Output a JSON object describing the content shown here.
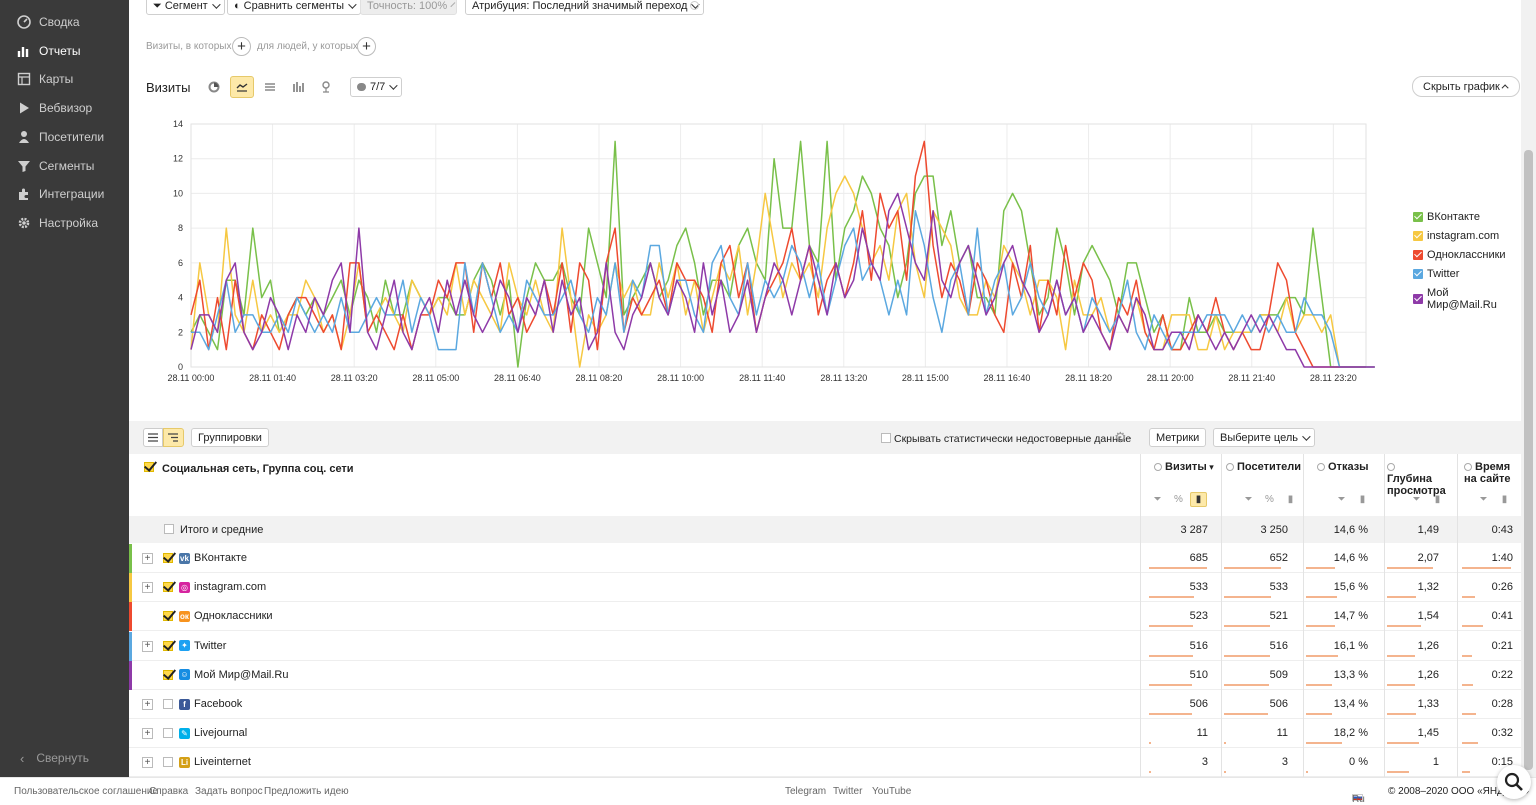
{
  "sidebar": {
    "items": [
      {
        "label": "Сводка",
        "icon": "dashboard-icon"
      },
      {
        "label": "Отчеты",
        "icon": "bar-chart-icon",
        "active": true
      },
      {
        "label": "Карты",
        "icon": "map-icon"
      },
      {
        "label": "Вебвизор",
        "icon": "play-icon"
      },
      {
        "label": "Посетители",
        "icon": "user-icon"
      },
      {
        "label": "Сегменты",
        "icon": "filter-icon"
      },
      {
        "label": "Интеграции",
        "icon": "puzzle-icon"
      },
      {
        "label": "Настройка",
        "icon": "gear-icon"
      }
    ],
    "collapse_label": "Свернуть"
  },
  "toolbar": {
    "segment_label": "Сегмент",
    "compare_label": "Сравнить сегменты",
    "accuracy_label": "Точность: 100%",
    "attribution_label": "Атрибуция: Последний значимый переход"
  },
  "conditions": {
    "visits_label": "Визиты, в которых",
    "people_label": "для людей, у которых"
  },
  "chart_header": {
    "title": "Визиты",
    "series_count": "7/7",
    "hide_chart_label": "Скрыть график"
  },
  "chart_data": {
    "type": "line",
    "ylim": [
      0,
      14
    ],
    "yticks": [
      0,
      2,
      4,
      6,
      8,
      10,
      12,
      14
    ],
    "xticks": [
      "28.11 00:00",
      "28.11 01:40",
      "28.11 03:20",
      "28.11 05:00",
      "28.11 06:40",
      "28.11 08:20",
      "28.11 10:00",
      "28.11 11:40",
      "28.11 13:20",
      "28.11 15:00",
      "28.11 16:40",
      "28.11 18:20",
      "28.11 20:00",
      "28.11 21:40",
      "28.11 23:20"
    ],
    "series": [
      {
        "name": "ВКонтакте",
        "color": "#79c04a",
        "values": [
          2,
          3,
          2,
          1,
          5,
          5,
          3,
          8,
          4,
          5,
          2,
          3,
          4,
          3,
          4,
          3,
          4,
          5,
          3,
          5,
          4,
          2,
          5,
          3,
          3,
          5,
          4,
          3,
          4,
          4,
          3,
          3,
          5,
          6,
          5,
          3,
          5,
          0,
          4,
          6,
          5,
          5,
          6,
          4,
          3,
          8,
          6,
          4,
          13,
          3,
          4,
          5,
          6,
          4,
          5,
          7,
          8,
          6,
          3,
          5,
          5,
          4,
          7,
          8,
          6,
          5,
          12,
          8,
          8,
          13,
          7,
          6,
          13,
          5,
          8,
          9,
          11,
          10,
          8,
          7,
          4,
          6,
          10,
          11,
          11,
          7,
          9,
          6,
          7,
          4,
          4,
          3,
          9,
          10,
          9,
          6,
          3,
          4,
          8,
          6,
          3,
          6,
          7,
          6,
          5,
          3,
          6,
          6,
          4,
          2,
          3,
          1,
          1,
          4,
          2,
          2,
          3,
          2,
          2,
          2,
          2,
          3,
          3,
          3,
          4,
          4,
          3,
          8,
          4,
          0,
          0,
          0,
          0,
          0
        ]
      },
      {
        "name": "instagram.com",
        "color": "#f6c842",
        "values": [
          1,
          6,
          3,
          2,
          8,
          3,
          2,
          5,
          2,
          3,
          2,
          3,
          3,
          5,
          4,
          2,
          3,
          1,
          3,
          6,
          2,
          3,
          4,
          3,
          2,
          5,
          4,
          3,
          4,
          3,
          6,
          3,
          5,
          4,
          3,
          2,
          6,
          4,
          3,
          5,
          3,
          2,
          8,
          4,
          0,
          3,
          2,
          3,
          6,
          4,
          5,
          3,
          3,
          6,
          4,
          6,
          3,
          5,
          2,
          4,
          6,
          5,
          7,
          3,
          6,
          10,
          7,
          4,
          6,
          5,
          6,
          4,
          8,
          10,
          11,
          10,
          8,
          6,
          7,
          5,
          9,
          10,
          6,
          4,
          9,
          8,
          7,
          4,
          3,
          3,
          5,
          4,
          7,
          6,
          5,
          3,
          5,
          5,
          4,
          1,
          5,
          3,
          3,
          4,
          2,
          3,
          2,
          4,
          2,
          1,
          1,
          3,
          3,
          3,
          1,
          1,
          3,
          1,
          2,
          2,
          2,
          3,
          3,
          2,
          4,
          2,
          3,
          3,
          2,
          3,
          0,
          0,
          0,
          0,
          0
        ]
      },
      {
        "name": "Одноклассники",
        "color": "#ee4a2f",
        "values": [
          3,
          5,
          1,
          4,
          1,
          5,
          2,
          1,
          3,
          2,
          1,
          3,
          4,
          4,
          3,
          2,
          3,
          1,
          6,
          6,
          2,
          3,
          2,
          1,
          3,
          1,
          3,
          3,
          5,
          4,
          6,
          6,
          2,
          6,
          4,
          6,
          3,
          4,
          2,
          3,
          5,
          3,
          6,
          2,
          6,
          5,
          1,
          6,
          8,
          2,
          4,
          3,
          4,
          5,
          3,
          6,
          5,
          5,
          4,
          2,
          6,
          7,
          4,
          6,
          2,
          4,
          5,
          6,
          8,
          5,
          7,
          3,
          5,
          6,
          4,
          6,
          9,
          5,
          10,
          8,
          9,
          5,
          11,
          13,
          7,
          4,
          6,
          5,
          3,
          6,
          5,
          3,
          2,
          6,
          4,
          7,
          2,
          5,
          3,
          7,
          4,
          6,
          5,
          2,
          1,
          4,
          3,
          5,
          2,
          1,
          3,
          1,
          1,
          2,
          3,
          2,
          4,
          2,
          1,
          2,
          1,
          1,
          3,
          6,
          5,
          2,
          1,
          0,
          0,
          0,
          0,
          0,
          0,
          0
        ]
      },
      {
        "name": "Twitter",
        "color": "#5ba8e0",
        "values": [
          2,
          2,
          1,
          3,
          5,
          2,
          3,
          3,
          2,
          2,
          3,
          2,
          4,
          3,
          2,
          3,
          2,
          4,
          2,
          2,
          3,
          4,
          3,
          3,
          5,
          2,
          4,
          3,
          1,
          1,
          1,
          6,
          3,
          6,
          4,
          2,
          3,
          2,
          5,
          4,
          3,
          3,
          4,
          5,
          3,
          2,
          4,
          3,
          6,
          2,
          5,
          4,
          7,
          7,
          3,
          5,
          5,
          3,
          2,
          6,
          7,
          4,
          3,
          6,
          3,
          5,
          4,
          5,
          7,
          6,
          4,
          6,
          3,
          5,
          7,
          8,
          5,
          6,
          5,
          3,
          5,
          3,
          9,
          7,
          4,
          2,
          5,
          6,
          3,
          8,
          3,
          5,
          6,
          3,
          4,
          6,
          4,
          3,
          5,
          3,
          4,
          2,
          4,
          3,
          2,
          3,
          5,
          2,
          1,
          3,
          2,
          1,
          2,
          2,
          2,
          3,
          3,
          3,
          2,
          3,
          2,
          3,
          2,
          3,
          2,
          2,
          4,
          3,
          3,
          2,
          0,
          0,
          0,
          0,
          0
        ]
      },
      {
        "name": "Мой Мир@Mail.Ru",
        "color": "#8e3aa8",
        "values": [
          1,
          3,
          3,
          2,
          5,
          6,
          2,
          1,
          2,
          4,
          3,
          1,
          3,
          2,
          4,
          3,
          5,
          6,
          2,
          8,
          2,
          1,
          3,
          5,
          2,
          1,
          3,
          4,
          2,
          5,
          3,
          5,
          3,
          2,
          3,
          5,
          4,
          2,
          4,
          3,
          5,
          2,
          5,
          3,
          4,
          1,
          2,
          6,
          2,
          1,
          3,
          4,
          6,
          4,
          3,
          5,
          4,
          2,
          6,
          3,
          5,
          2,
          3,
          5,
          2,
          4,
          6,
          5,
          3,
          5,
          7,
          5,
          3,
          6,
          4,
          5,
          8,
          6,
          5,
          9,
          10,
          8,
          6,
          5,
          9,
          5,
          4,
          6,
          7,
          5,
          3,
          4,
          6,
          7,
          5,
          4,
          2,
          3,
          5,
          3,
          4,
          2,
          3,
          2,
          1,
          3,
          2,
          4,
          3,
          1,
          1,
          2,
          2,
          1,
          3,
          2,
          1,
          2,
          1,
          2,
          3,
          2,
          3,
          2,
          1,
          1,
          0,
          0,
          0,
          0,
          0,
          0,
          0,
          0,
          0
        ]
      }
    ]
  },
  "table_toolbar": {
    "groupings_label": "Группировки",
    "hide_unreliable_label": "Скрывать статистически недостоверные данные",
    "metrics_label": "Метрики",
    "goal_label": "Выберите цель"
  },
  "table": {
    "dimension_header": "Социальная сеть, Группа соц. сети",
    "columns": [
      {
        "label": "Визиты",
        "sorted": true
      },
      {
        "label": "Посетители"
      },
      {
        "label": "Отказы"
      },
      {
        "label": "Глубина просмотра"
      },
      {
        "label": "Время на сайте"
      }
    ],
    "totals": {
      "label": "Итого и средние",
      "values": [
        "3 287",
        "3 250",
        "14,6 %",
        "1,49",
        "0:43"
      ]
    },
    "rows": [
      {
        "name": "ВКонтакте",
        "color": "#79c04a",
        "logo": "vk-icon",
        "logo_color": "#4a76a8",
        "expandable": true,
        "checked": true,
        "values": [
          "685",
          "652",
          "14,6 %",
          "2,07",
          "1:40"
        ],
        "shares": [
          0.96,
          0.95,
          0.52,
          0.83,
          0.95
        ]
      },
      {
        "name": "instagram.com",
        "color": "#f6c842",
        "logo": "instagram-icon",
        "logo_color": "#d6249f",
        "expandable": true,
        "checked": true,
        "values": [
          "533",
          "533",
          "15,6 %",
          "1,32",
          "0:26"
        ],
        "shares": [
          0.75,
          0.78,
          0.56,
          0.53,
          0.25
        ]
      },
      {
        "name": "Одноклассники",
        "color": "#ee4a2f",
        "logo": "ok-icon",
        "logo_color": "#f7931e",
        "expandable": false,
        "checked": true,
        "values": [
          "523",
          "521",
          "14,7 %",
          "1,54",
          "0:41"
        ],
        "shares": [
          0.74,
          0.76,
          0.53,
          0.62,
          0.4
        ]
      },
      {
        "name": "Twitter",
        "color": "#5ba8e0",
        "logo": "twitter-icon",
        "logo_color": "#1da1f2",
        "expandable": true,
        "checked": true,
        "values": [
          "516",
          "516",
          "16,1 %",
          "1,26",
          "0:21"
        ],
        "shares": [
          0.73,
          0.76,
          0.58,
          0.5,
          0.2
        ]
      },
      {
        "name": "Мой Мир@Mail.Ru",
        "color": "#8e3aa8",
        "logo": "moimir-icon",
        "logo_color": "#168de2",
        "expandable": false,
        "checked": true,
        "values": [
          "510",
          "509",
          "13,3 %",
          "1,26",
          "0:22"
        ],
        "shares": [
          0.72,
          0.75,
          0.48,
          0.5,
          0.21
        ]
      },
      {
        "name": "Facebook",
        "color": "",
        "logo": "facebook-icon",
        "logo_color": "#3b5998",
        "expandable": true,
        "checked": false,
        "values": [
          "506",
          "506",
          "13,4 %",
          "1,33",
          "0:28"
        ],
        "shares": [
          0.71,
          0.74,
          0.48,
          0.53,
          0.27
        ]
      },
      {
        "name": "Livejournal",
        "color": "",
        "logo": "livejournal-icon",
        "logo_color": "#00b0ea",
        "expandable": true,
        "checked": false,
        "values": [
          "11",
          "11",
          "18,2 %",
          "1,45",
          "0:32"
        ],
        "shares": [
          0.02,
          0.02,
          0.66,
          0.58,
          0.31
        ]
      },
      {
        "name": "Liveinternet",
        "color": "",
        "logo": "liveinternet-icon",
        "logo_color": "#d4a017",
        "expandable": true,
        "checked": false,
        "values": [
          "3",
          "3",
          "0 %",
          "1",
          "0:15"
        ],
        "shares": [
          0.01,
          0.01,
          0.0,
          0.4,
          0.15
        ]
      }
    ]
  },
  "footer": {
    "links": [
      "Пользовательское соглашение",
      "Справка",
      "Задать вопрос",
      "Предложить идею"
    ],
    "social": [
      "Telegram",
      "Twitter",
      "YouTube"
    ],
    "lang": "Ru",
    "copyright": "© 2008–2020 ООО «ЯНДЕКС»"
  }
}
